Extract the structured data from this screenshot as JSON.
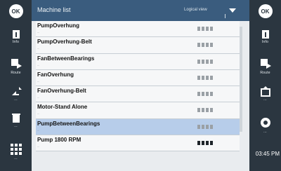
{
  "header": {
    "title": "Machine list",
    "dropdown_value": "Logical view",
    "accent": "#3a5c7e"
  },
  "left_bar": {
    "ok_label": "OK",
    "buttons": [
      {
        "icon": "info-icon",
        "caption": "Info"
      },
      {
        "icon": "route-icon",
        "caption": "Route"
      },
      {
        "icon": "arrows-icon",
        "caption": "..."
      },
      {
        "icon": "trash-icon",
        "caption": "..."
      },
      {
        "icon": "grid-icon",
        "caption": "..."
      }
    ]
  },
  "right_bar": {
    "ok_label": "OK",
    "buttons": [
      {
        "icon": "info-icon",
        "caption": "Info"
      },
      {
        "icon": "route-icon",
        "caption": "Route"
      },
      {
        "icon": "export-icon",
        "caption": "..."
      },
      {
        "icon": "record-icon",
        "caption": "..."
      }
    ],
    "time": "03:45 PM"
  },
  "machines": [
    {
      "name": "PumpOverhung",
      "meta": "...",
      "selected": false,
      "bars": "light"
    },
    {
      "name": "PumpOverhung-Belt",
      "meta": "...",
      "selected": false,
      "bars": "light"
    },
    {
      "name": "FanBetweenBearings",
      "meta": "...",
      "selected": false,
      "bars": "light"
    },
    {
      "name": "FanOverhung",
      "meta": "...",
      "selected": false,
      "bars": "light"
    },
    {
      "name": "FanOverhung-Belt",
      "meta": "...",
      "selected": false,
      "bars": "light"
    },
    {
      "name": "Motor-Stand Alone",
      "meta": "...",
      "selected": false,
      "bars": "light"
    },
    {
      "name": "PumpBetweenBearings",
      "meta": "...",
      "selected": true,
      "bars": "light"
    },
    {
      "name": "Pump 1800 RPM",
      "meta": "...",
      "selected": false,
      "bars": "dark"
    }
  ]
}
